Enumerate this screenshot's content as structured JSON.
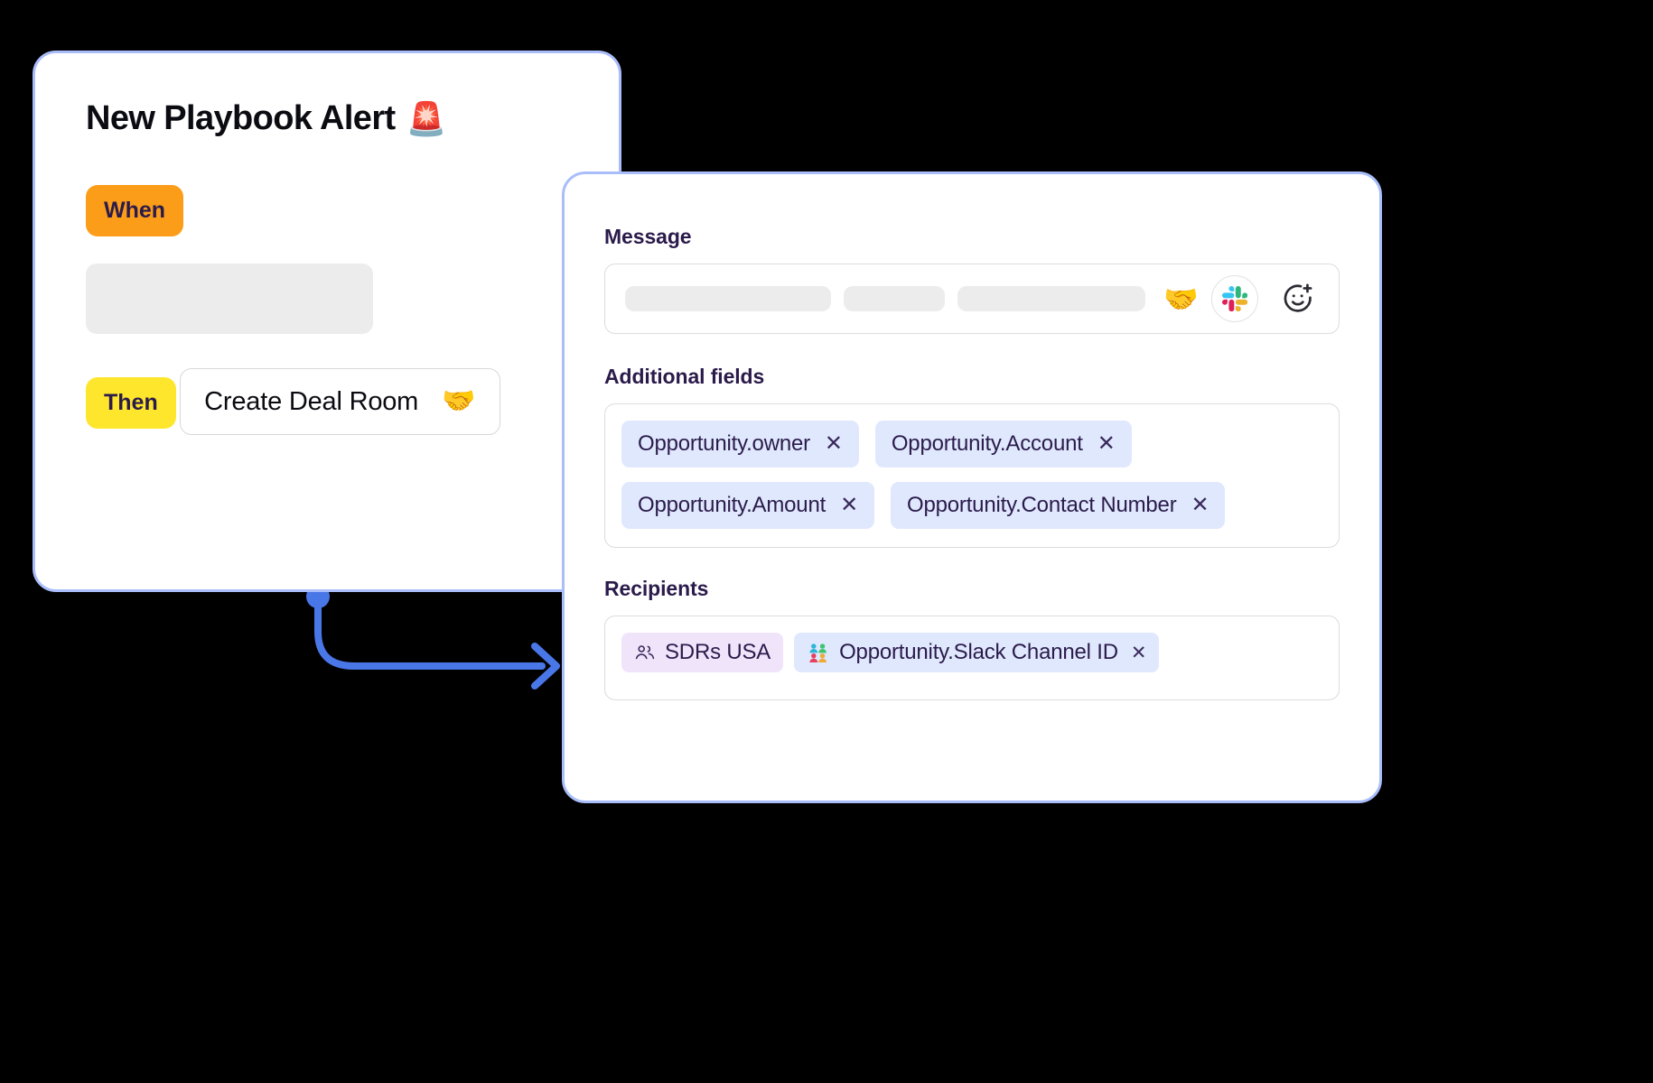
{
  "left_card": {
    "title": "New Playbook Alert",
    "title_emoji": "🚨",
    "when_label": "When",
    "then_label": "Then",
    "action_label": "Create Deal Room",
    "action_emoji": "🤝"
  },
  "right_card": {
    "message": {
      "label": "Message",
      "handshake_emoji": "🤝",
      "slack_icon": "slack-logo-icon",
      "emoji_picker_icon": "add-emoji-icon"
    },
    "additional_fields": {
      "label": "Additional fields",
      "tags": [
        {
          "text": "Opportunity.owner",
          "remove": "✕"
        },
        {
          "text": "Opportunity.Account",
          "remove": "✕"
        },
        {
          "text": "Opportunity.Amount",
          "remove": "✕"
        },
        {
          "text": "Opportunity.Contact Number",
          "remove": "✕"
        }
      ]
    },
    "recipients": {
      "label": "Recipients",
      "tags": [
        {
          "text": "SDRs USA",
          "style": "purple",
          "icon": "people-group-icon",
          "remove": ""
        },
        {
          "text": "Opportunity.Slack Channel ID",
          "style": "blue",
          "icon": "busts-in-silhouette-emoji",
          "remove": "✕"
        }
      ]
    }
  },
  "connector": {
    "name": "flow-connector-arrow",
    "color": "#4a77e8",
    "dot_color": "#4a77e8"
  },
  "colors": {
    "card_border": "#a9bdfb",
    "when_pill": "#fb9d19",
    "then_pill": "#fde62c",
    "tag_blue": "#dfe8fd",
    "tag_purple": "#f0e4fb",
    "heading": "#2b1b4b",
    "skeleton": "#ececec",
    "background": "#000000"
  }
}
